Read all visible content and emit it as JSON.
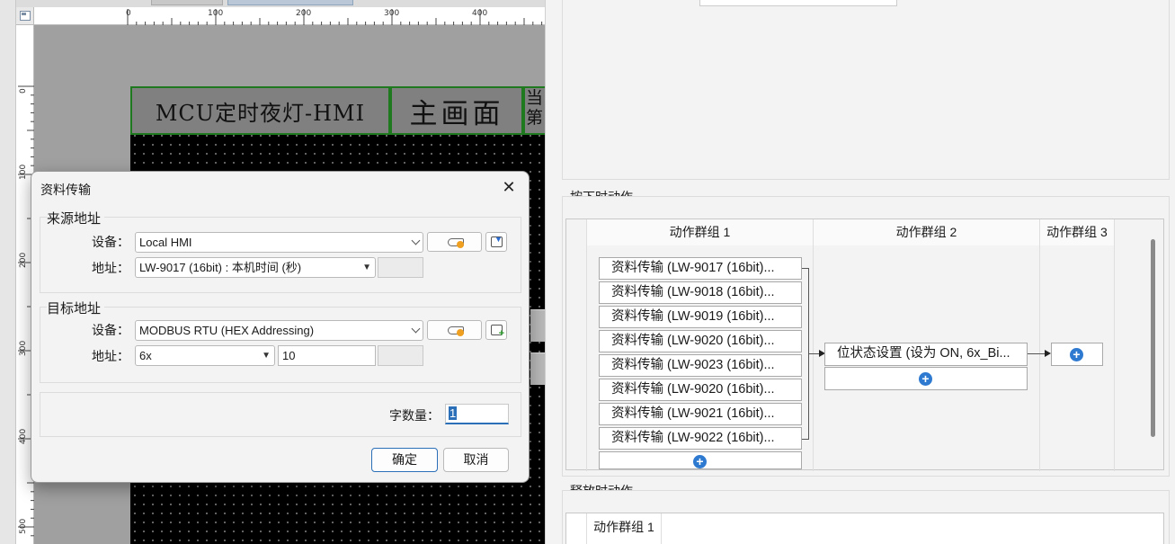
{
  "editor": {
    "ruler_top": [
      "0",
      "100",
      "200",
      "300",
      "400"
    ],
    "ruler_left": [
      "0",
      "100",
      "200",
      "300",
      "400",
      "500"
    ],
    "hmi": {
      "title": "MCU定时夜灯-HMI",
      "main": "主画面",
      "current_line1": "当",
      "current_line2": "第"
    }
  },
  "dialog": {
    "title": "资料传输",
    "close_glyph": "✕",
    "source": {
      "title": "来源地址",
      "device_label": "设备：",
      "device_value": "Local HMI",
      "address_label": "地址：",
      "address_value": "LW-9017 (16bit) : 本机时间 (秒)"
    },
    "target": {
      "title": "目标地址",
      "device_label": "设备：",
      "device_value": "MODBUS RTU (HEX Addressing)",
      "address_label": "地址：",
      "address_type": "6x",
      "address_value": "10"
    },
    "word_count_label": "字数量：",
    "word_count_value": "1",
    "ok_label": "确定",
    "cancel_label": "取消"
  },
  "right_panel": {
    "press_section": {
      "title": "按下时动作",
      "columns": [
        "动作群组 1",
        "动作群组 2",
        "动作群组 3"
      ],
      "group1_items": [
        "资料传输 (LW-9017 (16bit)...",
        "资料传输 (LW-9018 (16bit)...",
        "资料传输 (LW-9019 (16bit)...",
        "资料传输 (LW-9020 (16bit)...",
        "资料传输 (LW-9023 (16bit)...",
        "资料传输 (LW-9020 (16bit)...",
        "资料传输 (LW-9021 (16bit)...",
        "资料传输 (LW-9022 (16bit)..."
      ],
      "group2_items": [
        "位状态设置 (设为 ON, 6x_Bi..."
      ],
      "add_glyph": "+"
    },
    "release_section": {
      "title": "释放时动作",
      "columns": [
        "动作群组 1"
      ]
    }
  },
  "colors": {
    "accent_blue": "#2f7ad1",
    "hmi_border_green": "#1f7a1f",
    "hmi_gray": "#808080"
  }
}
